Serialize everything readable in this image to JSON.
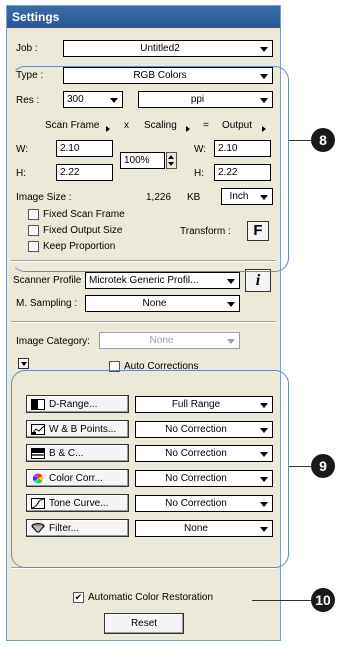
{
  "window": {
    "title": "Settings"
  },
  "job": {
    "label": "Job :",
    "value": "Untitled2"
  },
  "type": {
    "label": "Type :",
    "value": "RGB Colors"
  },
  "res": {
    "label": "Res :",
    "value": "300",
    "unit": "ppi"
  },
  "scan": {
    "scan_frame_label": "Scan Frame",
    "x_label": "x",
    "scaling_label": "Scaling",
    "eq_label": "=",
    "output_label": "Output",
    "w_label": "W:",
    "h_label": "H:",
    "w_in": "2.10",
    "h_in": "2.22",
    "scaling_value": "100%",
    "w_out": "2.10",
    "h_out": "2.22"
  },
  "image_size": {
    "label": "Image Size :",
    "value": "1,226",
    "unit": "KB",
    "units_select": "Inch"
  },
  "options": {
    "fixed_scan_frame": "Fixed Scan Frame",
    "fixed_output_size": "Fixed Output Size",
    "keep_proportion": "Keep Proportion",
    "transform_label": "Transform :",
    "transform_icon": "F"
  },
  "scanner_profile": {
    "label": "Scanner Profile :",
    "value": "Microtek Generic Profil...",
    "info_icon": "i"
  },
  "m_sampling": {
    "label": "M. Sampling :",
    "value": "None"
  },
  "image_category": {
    "label": "Image Category:",
    "value": "None"
  },
  "auto_corrections": {
    "label": "Auto Corrections"
  },
  "tools": [
    {
      "button": "D-Range...",
      "value": "Full Range",
      "icon": "d-range-icon"
    },
    {
      "button": "W & B Points...",
      "value": "No Correction",
      "icon": "wb-points-icon"
    },
    {
      "button": "B & C...",
      "value": "No Correction",
      "icon": "brightness-contrast-icon"
    },
    {
      "button": "Color Corr...",
      "value": "No Correction",
      "icon": "color-wheel-icon"
    },
    {
      "button": "Tone Curve...",
      "value": "No Correction",
      "icon": "tone-curve-icon"
    },
    {
      "button": "Filter...",
      "value": "None",
      "icon": "filter-icon"
    }
  ],
  "auto_color_restoration": {
    "label": "Automatic Color Restoration",
    "checked": true,
    "mark": "✔"
  },
  "reset": {
    "label": "Reset"
  },
  "callouts": {
    "c8": "8",
    "c9": "9",
    "c10": "10"
  },
  "colors": {
    "titlebar": "#2a5699",
    "panel": "#ece9d8",
    "bracket": "#6a8ab8"
  }
}
